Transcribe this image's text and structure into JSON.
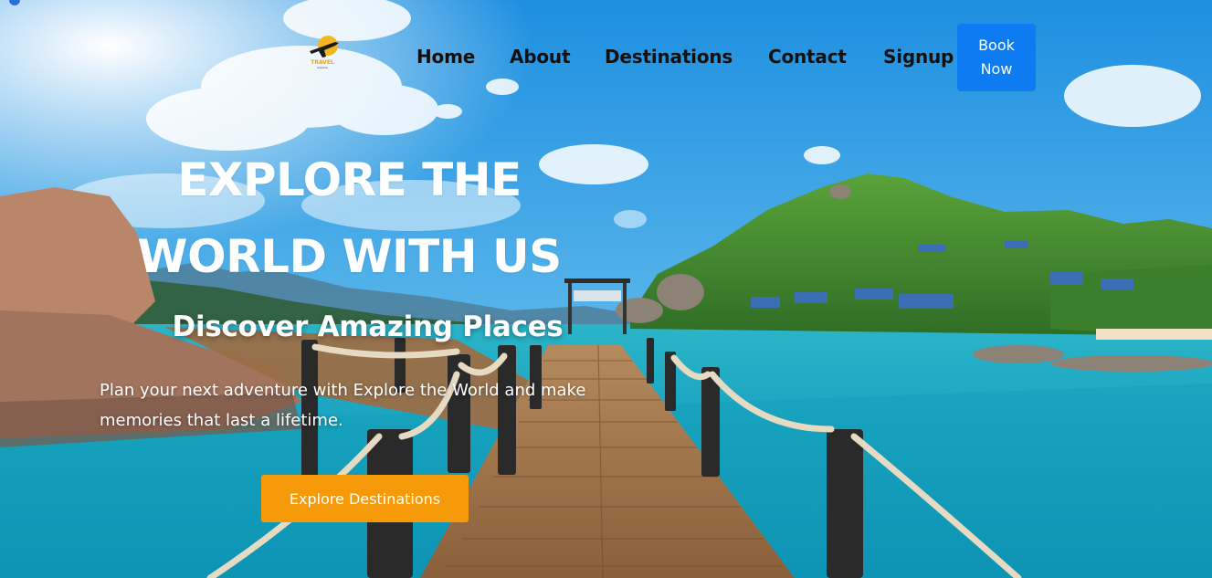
{
  "brand": {
    "logo_text": "TRAVEL",
    "logo_sub": "explore",
    "logo_icon": "airplane-icon",
    "accent": "#e8a21a"
  },
  "nav": {
    "items": [
      {
        "label": "Home"
      },
      {
        "label": "About"
      },
      {
        "label": "Destinations"
      },
      {
        "label": "Contact"
      },
      {
        "label": "Signup"
      }
    ],
    "book_label": "Book Now",
    "book_color": "#0d7bf2"
  },
  "hero": {
    "headline": "EXPLORE THE WORLD WITH US",
    "subhead": "Discover Amazing Places",
    "description": "Plan your next adventure with Explore the World and make memories that last a lifetime.",
    "cta_label": "Explore Destinations",
    "cta_color": "#f79a09"
  }
}
